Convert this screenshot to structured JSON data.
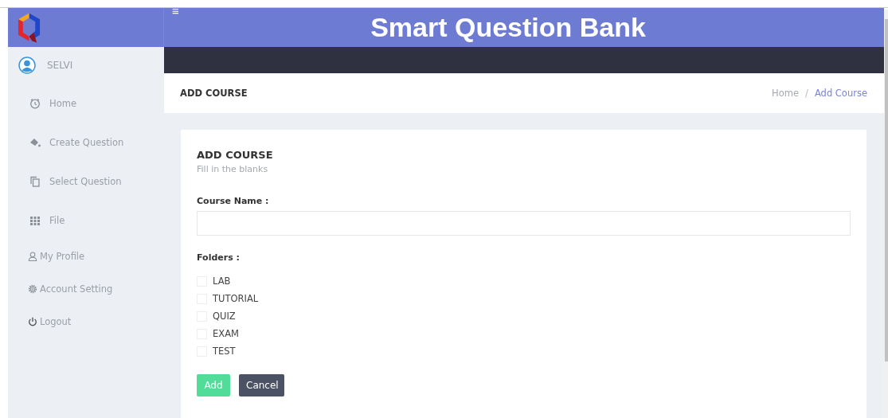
{
  "header": {
    "menu_glyph": "≡",
    "title": "Smart Question Bank"
  },
  "sidebar": {
    "user": "SELVI",
    "items": [
      {
        "label": "Home",
        "kind": "clock"
      },
      {
        "label": "Create Question",
        "kind": "bucket"
      },
      {
        "label": "Select Question",
        "kind": "copy"
      },
      {
        "label": "File",
        "kind": "grid"
      },
      {
        "label": "My Profile",
        "kind": "person"
      },
      {
        "label": "Account Setting",
        "kind": "gear"
      },
      {
        "label": "Logout",
        "kind": "power"
      }
    ]
  },
  "page_header": {
    "title": "ADD COURSE",
    "breadcrumb": [
      {
        "label": "Home",
        "selected": false
      },
      {
        "label": "Add Course",
        "selected": true
      }
    ],
    "separator": "/"
  },
  "form": {
    "title": "ADD COURSE",
    "subtitle": "Fill in the blanks",
    "course_name_label": "Course Name :",
    "folders_label": "Folders :",
    "folders": [
      {
        "label": "LAB",
        "checked": false
      },
      {
        "label": "TUTORIAL",
        "checked": false
      },
      {
        "label": "QUIZ",
        "checked": false
      },
      {
        "label": "EXAM",
        "checked": false
      },
      {
        "label": "TEST",
        "checked": false
      }
    ],
    "buttons": [
      {
        "label": "Add",
        "kind": "primary"
      },
      {
        "label": "Cancel",
        "kind": "secondary"
      }
    ]
  }
}
